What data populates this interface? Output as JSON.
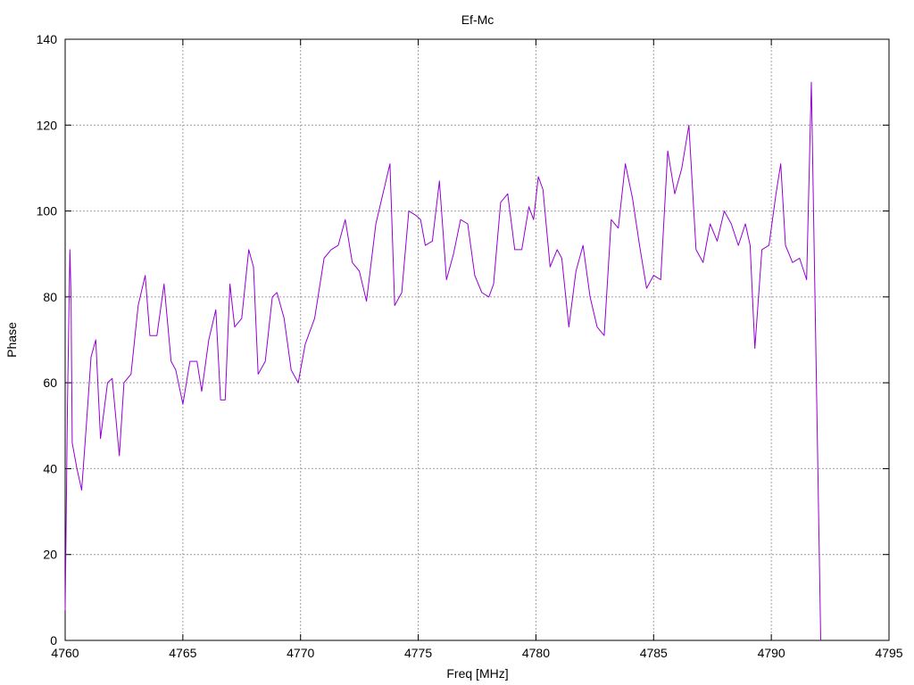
{
  "chart_data": {
    "type": "line",
    "title": "Ef-Mc",
    "xlabel": "Freq [MHz]",
    "ylabel": "Phase",
    "xlim": [
      4760,
      4795
    ],
    "ylim": [
      0,
      140
    ],
    "xticks": [
      4760,
      4765,
      4770,
      4775,
      4780,
      4785,
      4790,
      4795
    ],
    "yticks": [
      0,
      20,
      40,
      60,
      80,
      100,
      120,
      140
    ],
    "grid": true,
    "legend": "none",
    "series": [
      {
        "color": "#9400d3",
        "x": [
          4760.0,
          4760.1,
          4760.2,
          4760.25,
          4760.3,
          4760.5,
          4760.7,
          4760.9,
          4761.1,
          4761.3,
          4761.5,
          4761.8,
          4762.0,
          4762.3,
          4762.5,
          4762.8,
          4763.1,
          4763.4,
          4763.6,
          4763.9,
          4764.2,
          4764.5,
          4764.7,
          4765.0,
          4765.3,
          4765.6,
          4765.8,
          4766.1,
          4766.4,
          4766.6,
          4766.8,
          4767.0,
          4767.2,
          4767.5,
          4767.8,
          4768.0,
          4768.2,
          4768.5,
          4768.8,
          4769.0,
          4769.3,
          4769.6,
          4769.9,
          4770.2,
          4770.6,
          4771.0,
          4771.3,
          4771.6,
          4771.9,
          4772.2,
          4772.5,
          4772.8,
          4773.2,
          4773.5,
          4773.8,
          4774.0,
          4774.3,
          4774.6,
          4774.9,
          4775.1,
          4775.3,
          4775.6,
          4775.9,
          4776.2,
          4776.5,
          4776.8,
          4777.1,
          4777.4,
          4777.7,
          4778.0,
          4778.2,
          4778.5,
          4778.8,
          4779.1,
          4779.4,
          4779.7,
          4779.9,
          4780.1,
          4780.3,
          4780.6,
          4780.9,
          4781.1,
          4781.4,
          4781.7,
          4782.0,
          4782.3,
          4782.6,
          4782.9,
          4783.2,
          4783.5,
          4783.8,
          4784.1,
          4784.4,
          4784.7,
          4785.0,
          4785.3,
          4785.6,
          4785.9,
          4786.2,
          4786.5,
          4786.8,
          4787.1,
          4787.4,
          4787.7,
          4788.0,
          4788.3,
          4788.6,
          4788.9,
          4789.1,
          4789.3,
          4789.6,
          4789.9,
          4790.2,
          4790.4,
          4790.6,
          4790.9,
          4791.2,
          4791.5,
          4791.7,
          4791.9,
          4792.1
        ],
        "y": [
          7,
          55,
          91,
          80,
          46,
          40,
          35,
          50,
          66,
          70,
          47,
          60,
          61,
          43,
          60,
          62,
          78,
          85,
          71,
          71,
          83,
          65,
          63,
          55,
          65,
          65,
          58,
          70,
          77,
          56,
          56,
          83,
          73,
          75,
          91,
          87,
          62,
          65,
          80,
          81,
          75,
          63,
          60,
          69,
          75,
          89,
          91,
          92,
          98,
          88,
          86,
          79,
          97,
          104,
          111,
          78,
          81,
          100,
          99,
          98,
          92,
          93,
          107,
          84,
          90,
          98,
          97,
          85,
          81,
          80,
          83,
          102,
          104,
          91,
          91,
          101,
          98,
          108,
          105,
          87,
          91,
          89,
          73,
          86,
          92,
          80,
          73,
          71,
          98,
          96,
          111,
          103,
          92,
          82,
          85,
          84,
          114,
          104,
          110,
          120,
          91,
          88,
          97,
          93,
          100,
          97,
          92,
          97,
          92,
          68,
          91,
          92,
          104,
          111,
          92,
          88,
          89,
          84,
          130,
          66,
          0
        ]
      }
    ]
  }
}
